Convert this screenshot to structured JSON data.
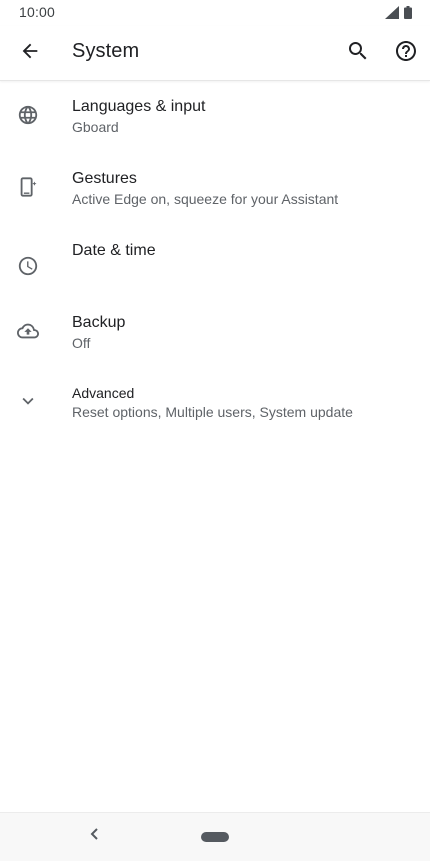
{
  "status_bar": {
    "time": "10:00"
  },
  "app_bar": {
    "title": "System",
    "icons": {
      "back": "arrow-back-icon",
      "search": "search-icon",
      "help": "help-icon"
    }
  },
  "settings": [
    {
      "title": "Languages & input",
      "summary": "Gboard",
      "icon": "globe-icon"
    },
    {
      "title": "Gestures",
      "summary": "Active Edge on, squeeze for your Assistant",
      "icon": "phone-gesture-icon"
    },
    {
      "title": "Date & time",
      "summary": "",
      "icon": "clock-icon"
    },
    {
      "title": "Backup",
      "summary": "Off",
      "icon": "cloud-upload-icon"
    },
    {
      "title": "Advanced",
      "summary": "Reset options, Multiple users, System update",
      "icon": "chevron-down-icon"
    }
  ],
  "colors": {
    "primary_text": "#202124",
    "secondary_text": "#5f6368",
    "icon": "#5f6368"
  }
}
